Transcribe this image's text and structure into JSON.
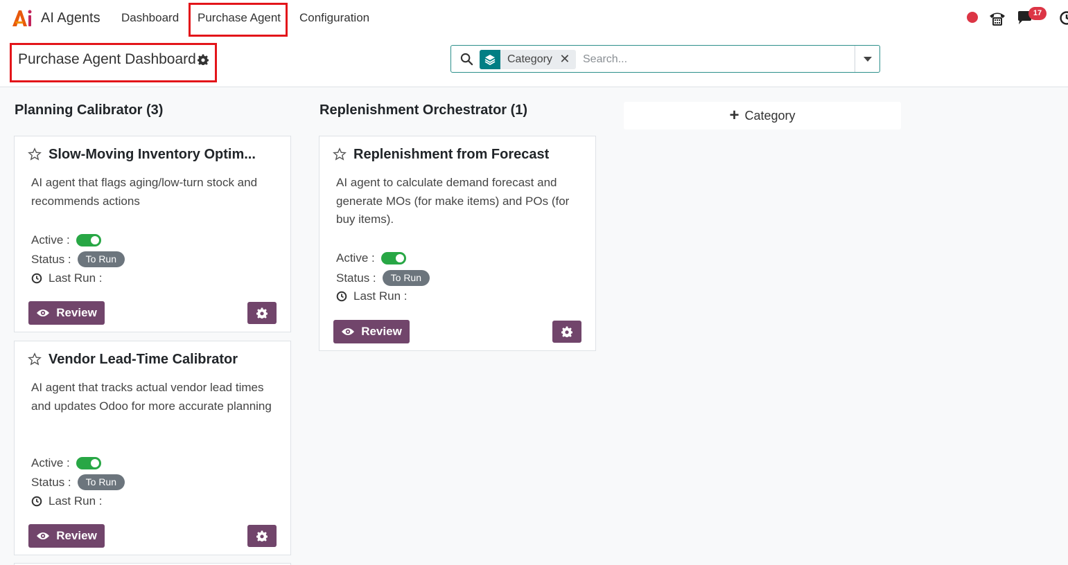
{
  "app": {
    "name": "AI Agents",
    "nav": [
      {
        "label": "Dashboard"
      },
      {
        "label": "Purchase Agent"
      },
      {
        "label": "Configuration"
      }
    ],
    "chat_count": "17"
  },
  "control": {
    "title": "Purchase Agent Dashboard",
    "search": {
      "facet_label": "Category",
      "facet_remove": "✕",
      "placeholder": "Search..."
    }
  },
  "kanban": {
    "add_column_label": "Category",
    "columns": [
      {
        "title": "Planning Calibrator (3)",
        "cards": [
          {
            "title": "Slow-Moving Inventory Optim...",
            "description": "AI agent that flags aging/low-turn stock and recommends actions",
            "active_label": "Active :",
            "status_label": "Status :",
            "status_value": "To Run",
            "last_run_label": "Last Run :",
            "review_label": "Review"
          },
          {
            "title": "Vendor Lead-Time Calibrator",
            "description": "AI agent that tracks actual vendor lead times and updates Odoo for more accurate planning",
            "active_label": "Active :",
            "status_label": "Status :",
            "status_value": "To Run",
            "last_run_label": "Last Run :",
            "review_label": "Review"
          }
        ]
      },
      {
        "title": "Replenishment Orchestrator (1)",
        "cards": [
          {
            "title": "Replenishment from Forecast",
            "description": "AI agent to calculate demand forecast and generate MOs (for make items) and POs (for buy items).",
            "active_label": "Active :",
            "status_label": "Status :",
            "status_value": "To Run",
            "last_run_label": "Last Run :",
            "review_label": "Review"
          }
        ]
      }
    ]
  }
}
